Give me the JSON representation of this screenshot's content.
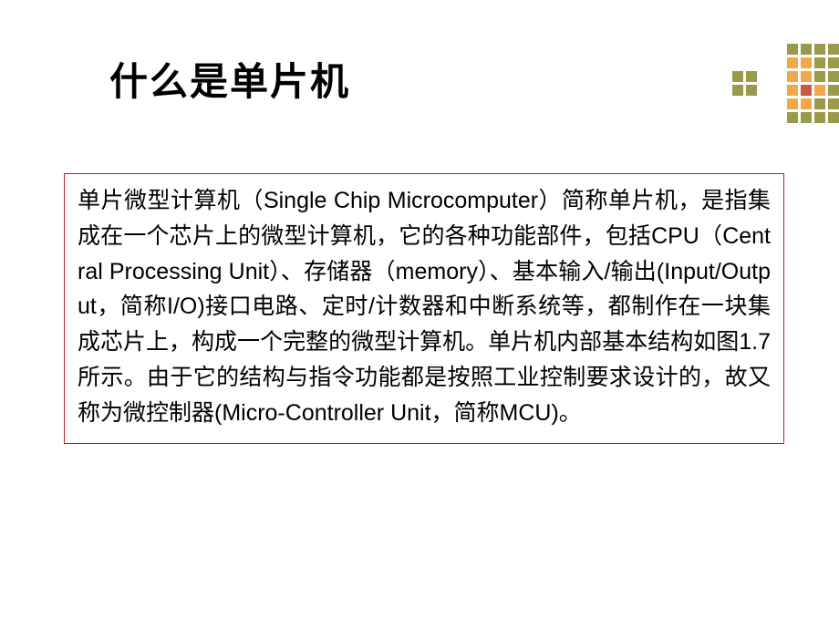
{
  "slide": {
    "title": "什么是单片机",
    "body": "单片微型计算机（Single Chip Microcomputer）简称单片机，是指集成在一个芯片上的微型计算机，它的各种功能部件，包括CPU（Central Processing Unit）、存储器（memory）、基本输入/输出(Input/Output，简称I/O)接口电路、定时/计数器和中断系统等，都制作在一块集成芯片上，构成一个完整的微型计算机。单片机内部基本结构如图1.7所示。由于它的结构与指令功能都是按照工业控制要求设计的，故又称为微控制器(Micro-Controller Unit，简称MCU)。"
  },
  "decoration": {
    "name": "corner-dot-grid",
    "palette": {
      "olive": "#9a9a4a",
      "orange": "#f0a848",
      "red": "#c85a40"
    }
  }
}
